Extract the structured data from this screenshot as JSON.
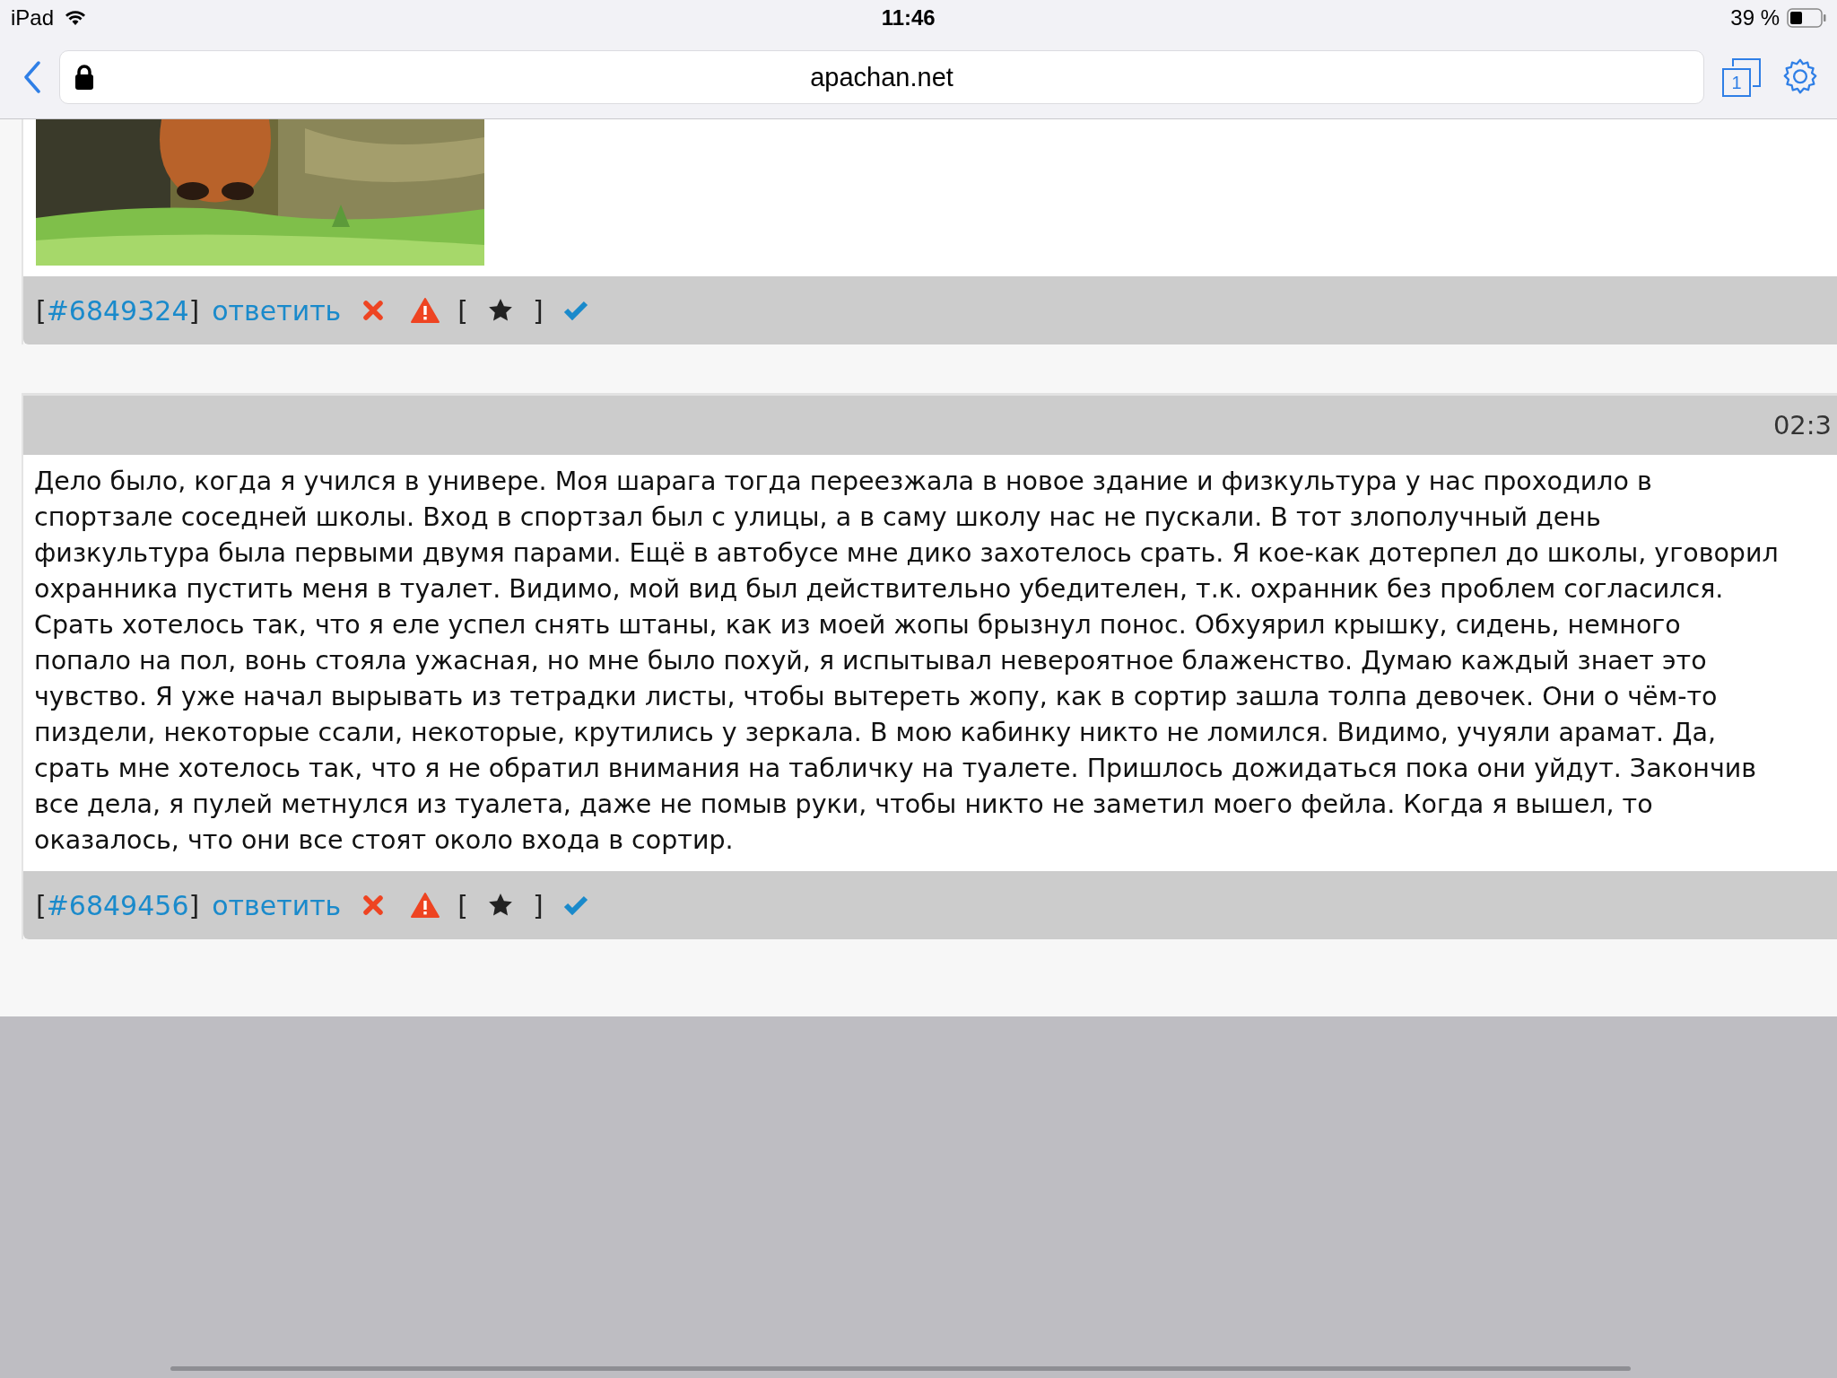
{
  "status_bar": {
    "device": "iPad",
    "time": "11:46",
    "battery": "39 %"
  },
  "browser": {
    "url": "apachan.net",
    "tab_count": "1"
  },
  "posts": [
    {
      "footer": [
        {
          "kind": "bracket",
          "text": "["
        },
        {
          "kind": "link",
          "text": "#6849324"
        },
        {
          "kind": "bracket",
          "text": "]"
        },
        {
          "kind": "link",
          "text": "ответить"
        },
        {
          "kind": "cross"
        },
        {
          "kind": "warning"
        },
        {
          "kind": "bracket",
          "text": "["
        },
        {
          "kind": "star"
        },
        {
          "kind": "bracket",
          "text": "]"
        },
        {
          "kind": "check"
        }
      ]
    },
    {
      "kind": "text",
      "time": "02:3",
      "lines": [
        "Дело было, когда я учился в универе. Моя шарага тогда переезжала в новое здание и физкультура у нас проходило в",
        "спортзале соседней школы. Вход в спортзал был с улицы, а в саму школу нас не пускали. В тот злополучный день",
        "физкультура была первыми двумя парами. Ещё в автобусе мне дико захотелось срать. Я кое-как дотерпел до школы, уговорил",
        "охранника пустить меня в туалет. Видимо, мой вид был действительно убедителен, т.к. охранник без проблем согласился.",
        "Срать хотелось так, что я еле успел снять штаны, как из моей жопы брызнул понос. Обхуярил крышку, сидень, немного",
        "попало на пол, вонь стояла ужасная, но мне было похуй, я испытывал невероятное блаженство. Думаю каждый знает это",
        "чувство. Я уже начал вырывать из тетрадки листы, чтобы вытереть жопу, как в сортир зашла толпа девочек. Они о чём-то",
        "пиздели, некоторые ссали, некоторые, крутились у зеркала. В мою кабинку никто не ломился. Видимо, учуяли арамат. Да,",
        "срать мне хотелось так, что я не обратил внимания на табличку на туалете. Пришлось дожидаться пока они уйдут. Закончив",
        "все дела, я пулей метнулся из туалета, даже не помыв руки, чтобы никто не заметил моего фейла. Когда я вышел, то",
        "оказалось, что они все стоят около входа в сортир."
      ],
      "footer": [
        {
          "kind": "bracket",
          "text": "["
        },
        {
          "kind": "link",
          "text": "#6849456"
        },
        {
          "kind": "bracket",
          "text": "]"
        },
        {
          "kind": "link",
          "text": "ответить"
        },
        {
          "kind": "cross"
        },
        {
          "kind": "warning"
        },
        {
          "kind": "bracket",
          "text": "["
        },
        {
          "kind": "star"
        },
        {
          "kind": "bracket",
          "text": "]"
        },
        {
          "kind": "check"
        }
      ]
    }
  ]
}
